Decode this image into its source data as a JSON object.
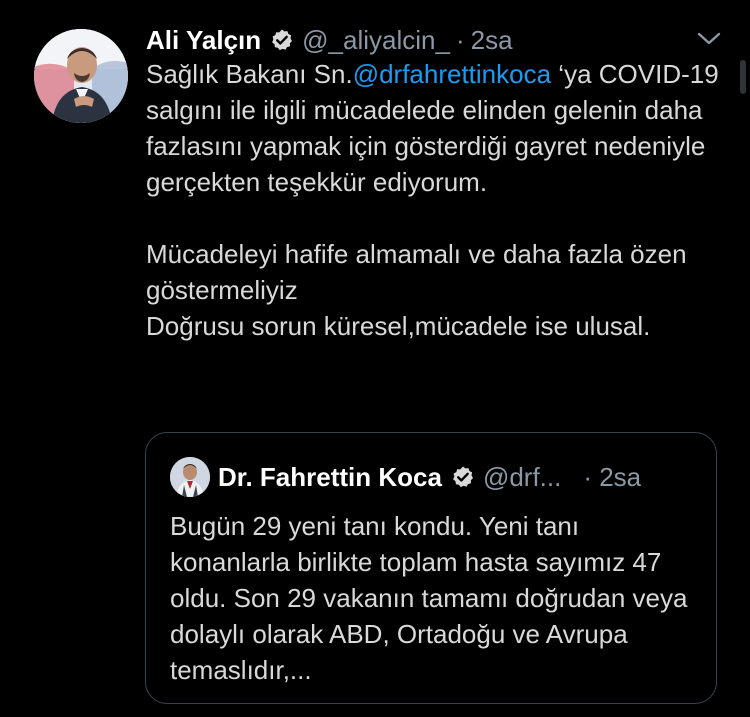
{
  "tweet": {
    "author_name": "Ali Yalçın",
    "handle": "@_aliyalcin_",
    "separator": "·",
    "time": "2sa",
    "text_before_mention": "Sağlık Bakanı Sn.",
    "mention": "@drfahrettinkoca",
    "text_after_mention": " ‘ya COVID-19 salgını ile ilgili mücadelede elinden gelenin daha fazlasını yapmak için gösterdiği gayret nedeniyle gerçekten teşekkür ediyorum.",
    "paragraph2_line1": "Mücadeleyi hafife almamalı ve daha fazla özen göstermeliyiz",
    "paragraph2_line2": "Doğrusu sorun küresel,mücadele ise ulusal."
  },
  "quoted_tweet": {
    "author_name": "Dr. Fahrettin Koca",
    "handle": "@drf...",
    "time": "· 2sa",
    "text": "Bugün 29 yeni tanı kondu. Yeni tanı konanlarla birlikte toplam hasta sayımız 47 oldu. Son 29 vakanın tamamı doğrudan veya dolaylı olarak ABD, Ortadoğu ve Avrupa temaslıdır,..."
  },
  "icons": {
    "verified": "verified-badge-icon",
    "menu": "chevron-down-icon"
  },
  "colors": {
    "background": "#000000",
    "link": "#1d9bf0",
    "secondary_text": "#8b98a5",
    "border": "#38444d"
  }
}
